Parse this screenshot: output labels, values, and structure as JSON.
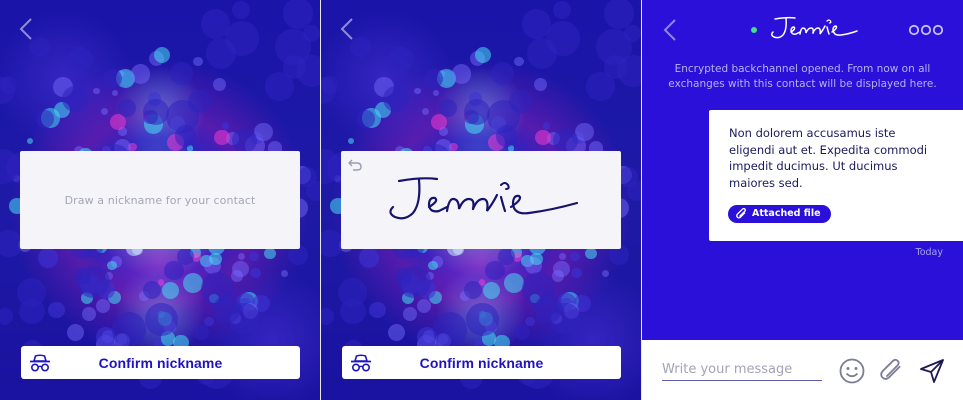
{
  "screen1": {
    "draw_hint": "Draw a nickname for your contact",
    "confirm_label": "Confirm nickname"
  },
  "screen2": {
    "drawn_nickname": "Jennie",
    "confirm_label": "Confirm nickname"
  },
  "chat": {
    "contact_name": "Jennie",
    "status": "online",
    "system_message": "Encrypted backchannel opened. From now on all exchanges with this contact will be displayed here.",
    "message": {
      "text": "Non dolorem accusamus iste eligendi aut et. Expedita commodi impedit ducimus. Ut ducimus maiores sed.",
      "attachment_label": "Attached file",
      "timestamp": "Today"
    },
    "composer_placeholder": "Write your message"
  },
  "colors": {
    "brand": "#2a10d9",
    "button_text": "#1f13bf",
    "online": "#3ee08a",
    "card": "#f5f5f9"
  },
  "icons": [
    "back-arrow-icon",
    "incognito-icon",
    "undo-icon",
    "more-options-icon",
    "emoji-icon",
    "paperclip-icon",
    "send-icon"
  ]
}
